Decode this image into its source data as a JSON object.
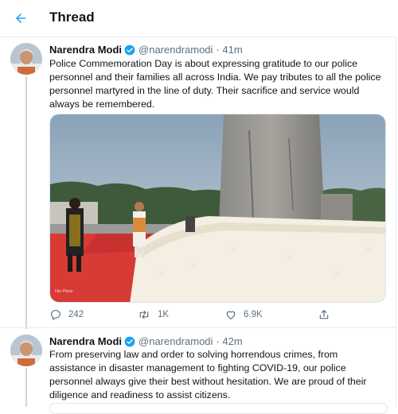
{
  "header": {
    "title": "Thread",
    "back_icon": "arrow-left-icon"
  },
  "accent": "#1da1f2",
  "tweets": [
    {
      "author_name": "Narendra Modi",
      "handle": "@narendramodi",
      "time": "· 41m",
      "text": "Police Commemoration Day is  about expressing gratitude to our police personnel and their families all across India. We pay tributes to all the police personnel martyred in the line of duty. Their sacrifice and service would always be remembered.",
      "media_credit": "File Photo",
      "replies": "242",
      "retweets": "1K",
      "likes": "6.9K"
    },
    {
      "author_name": "Narendra Modi",
      "handle": "@narendramodi",
      "time": "· 42m",
      "text": "From preserving law and order to solving horrendous crimes, from assistance in disaster management to fighting COVID-19, our police personnel always give their best without hesitation. We are proud of their diligence and readiness to assist citizens."
    }
  ]
}
